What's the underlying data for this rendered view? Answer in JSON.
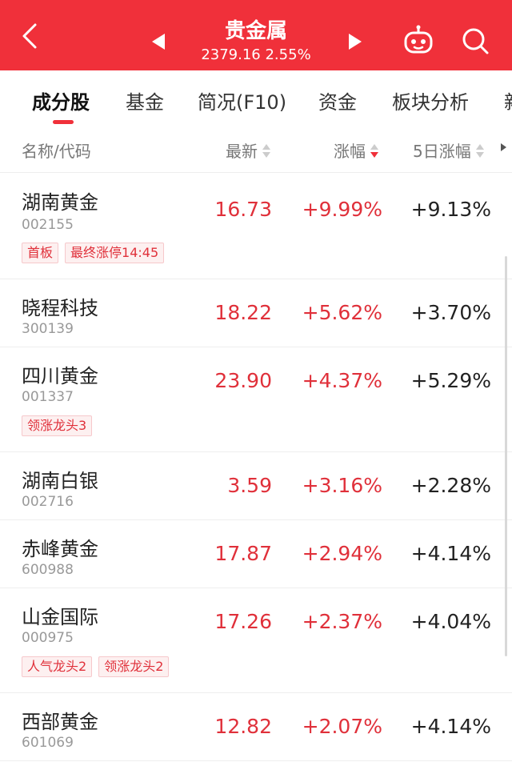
{
  "header": {
    "title": "贵金属",
    "subtitle": "2379.16 2.55%",
    "color": "#f0303a"
  },
  "tabs": [
    {
      "label": "成分股",
      "active": true
    },
    {
      "label": "基金"
    },
    {
      "label": "简况(F10)"
    },
    {
      "label": "资金"
    },
    {
      "label": "板块分析"
    },
    {
      "label": "新"
    }
  ],
  "columns": {
    "name": "名称/代码",
    "latest": "最新",
    "change": "涨幅",
    "change5": "5日涨幅"
  },
  "rows": [
    {
      "name": "湖南黄金",
      "code": "002155",
      "price": "16.73",
      "change": "+9.99%",
      "change5": "+9.13%",
      "tags": [
        "首板",
        "最终涨停14:45"
      ]
    },
    {
      "name": "晓程科技",
      "code": "300139",
      "price": "18.22",
      "change": "+5.62%",
      "change5": "+3.70%",
      "tags": []
    },
    {
      "name": "四川黄金",
      "code": "001337",
      "price": "23.90",
      "change": "+4.37%",
      "change5": "+5.29%",
      "tags": [
        "领涨龙头3"
      ]
    },
    {
      "name": "湖南白银",
      "code": "002716",
      "price": "3.59",
      "change": "+3.16%",
      "change5": "+2.28%",
      "tags": []
    },
    {
      "name": "赤峰黄金",
      "code": "600988",
      "price": "17.87",
      "change": "+2.94%",
      "change5": "+4.14%",
      "tags": []
    },
    {
      "name": "山金国际",
      "code": "000975",
      "price": "17.26",
      "change": "+2.37%",
      "change5": "+4.04%",
      "tags": [
        "人气龙头2",
        "领涨龙头2"
      ]
    },
    {
      "name": "西部黄金",
      "code": "601069",
      "price": "12.82",
      "change": "+2.07%",
      "change5": "+4.14%",
      "tags": []
    }
  ],
  "colors": {
    "up": "#e0303a",
    "tag_bg": "#fdf0f0",
    "tag_border": "#f6c8cb"
  },
  "icons": [
    "back-icon",
    "prev-arrow-icon",
    "next-arrow-icon",
    "robot-icon",
    "search-icon",
    "sort-icon"
  ]
}
